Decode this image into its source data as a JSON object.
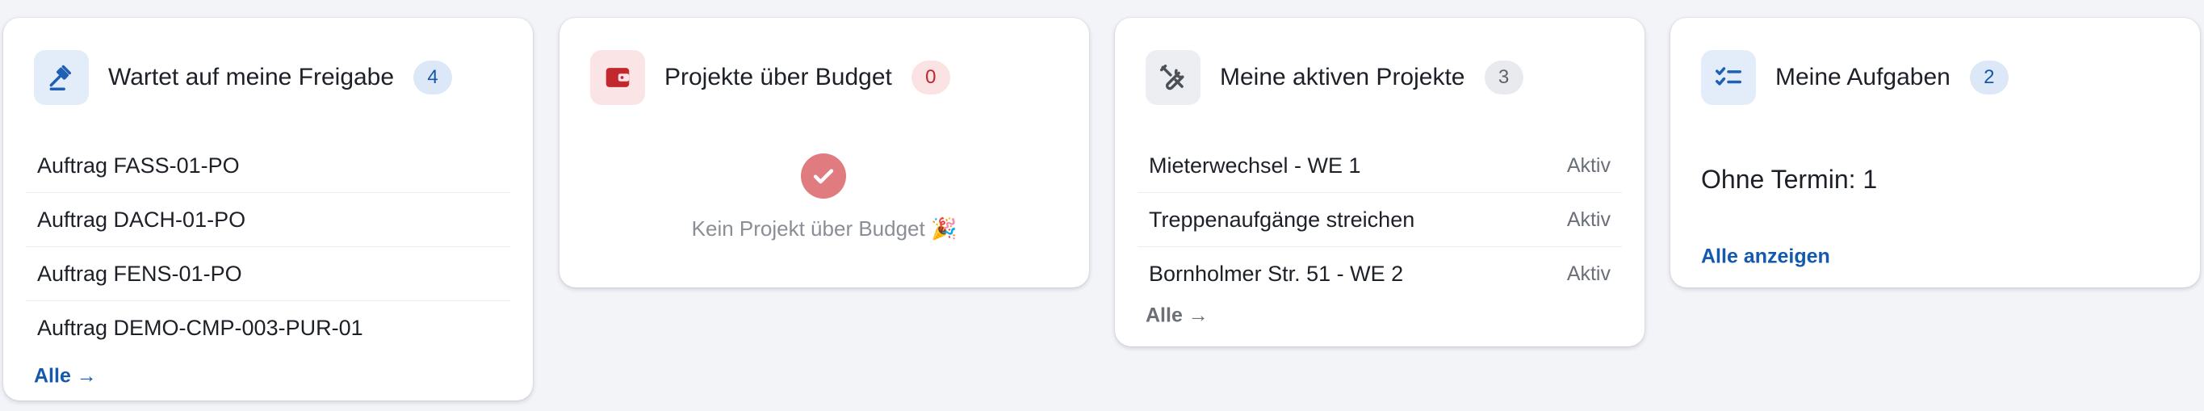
{
  "cards": [
    {
      "title": "Wartet auf meine Freigabe",
      "badge": "4",
      "icon": "gavel-icon",
      "items": [
        "Auftrag FASS-01-PO",
        "Auftrag DACH-01-PO",
        "Auftrag FENS-01-PO",
        "Auftrag DEMO-CMP-003-PUR-01"
      ],
      "link": "Alle →"
    },
    {
      "title": "Projekte über Budget",
      "badge": "0",
      "icon": "wallet-icon",
      "empty_text": "Kein Projekt über Budget 🎉",
      "empty_icon": "check-circle-icon"
    },
    {
      "title": "Meine aktiven Projekte",
      "badge": "3",
      "icon": "tools-icon",
      "items": [
        {
          "name": "Mieterwechsel - WE 1",
          "status": "Aktiv"
        },
        {
          "name": "Treppenaufgänge streichen",
          "status": "Aktiv"
        },
        {
          "name": "Bornholmer Str. 51 - WE 2",
          "status": "Aktiv"
        }
      ],
      "link": "Alle →"
    },
    {
      "title": "Meine Aufgaben",
      "badge": "2",
      "icon": "checklist-icon",
      "summary": "Ohne Termin: 1",
      "link": "Alle anzeigen"
    }
  ],
  "colors": {
    "background": "#f3f4f8",
    "card": "#ffffff",
    "accent_blue": "#1459ad",
    "accent_red": "#c0262d",
    "check_red": "#e07b80",
    "muted_text": "#6b7078"
  }
}
